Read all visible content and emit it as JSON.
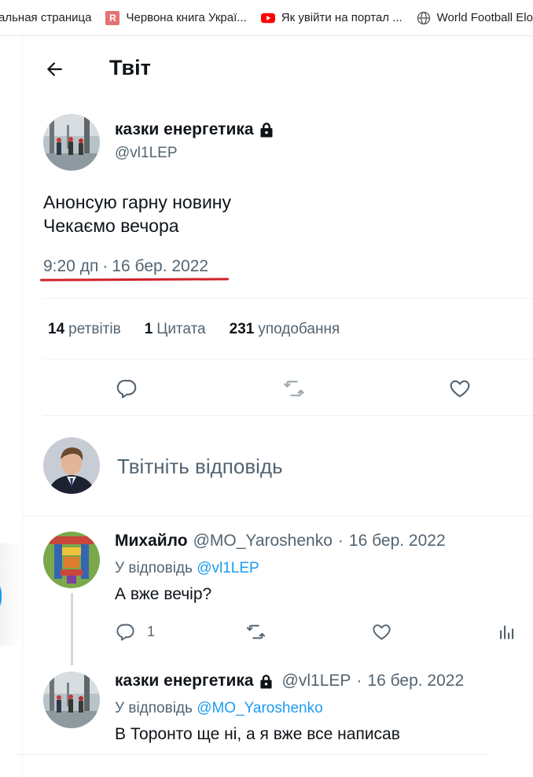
{
  "bookmarks": [
    {
      "label": "альная страница",
      "icon": "page-icon"
    },
    {
      "label": "Червона книга Украї...",
      "icon": "r-favicon"
    },
    {
      "label": "Як увійти на портал ...",
      "icon": "youtube-icon"
    },
    {
      "label": "World Football Elo",
      "icon": "globe-icon"
    }
  ],
  "header": {
    "title": "Твіт"
  },
  "tweet": {
    "author_name": "казки енергетика",
    "author_handle": "@vl1LEP",
    "text_line1": "Анонсую гарну новину",
    "text_line2": "Чекаємо вечора",
    "time": "9:20 дп",
    "separator": "·",
    "date": "16 бер. 2022",
    "stats": {
      "retweets_count": "14",
      "retweets_label": "ретвітів",
      "quotes_count": "1",
      "quotes_label": "Цитата",
      "likes_count": "231",
      "likes_label": "уподобання"
    }
  },
  "reply_box": {
    "placeholder": "Твітніть відповідь"
  },
  "replies": [
    {
      "name": "Михайло",
      "handle": "@MO_Yaroshenko",
      "separator": "·",
      "date": "16 бер. 2022",
      "reply_to_prefix": "У відповідь",
      "reply_to_handle": "@vl1LEP",
      "text": "А вже вечір?",
      "reply_count": "1"
    },
    {
      "name": "казки енергетика",
      "handle": "@vl1LEP",
      "separator": "·",
      "date": "16 бер. 2022",
      "reply_to_prefix": "У відповідь",
      "reply_to_handle": "@MO_Yaroshenko",
      "text": "В Торонто ще ні, а я вже все написав"
    }
  ],
  "colors": {
    "accent": "#1d9bf0",
    "muted": "#536471",
    "text": "#0f1419",
    "annotation": "#d0202a"
  }
}
